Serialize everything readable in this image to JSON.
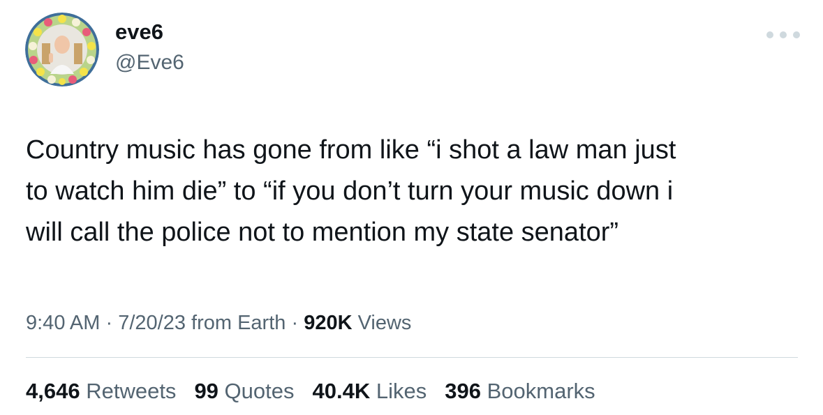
{
  "author": {
    "display_name": "eve6",
    "handle": "@Eve6",
    "avatar_icon": "profile-avatar-flower-wreath"
  },
  "more_icon": "more-options-dots-icon",
  "tweet": {
    "text": "Country music has gone from like “i shot a law man just\nto watch him die” to “if you don’t turn your music down i\nwill call the police not to mention my state senator”"
  },
  "meta": {
    "time": "9:40 AM",
    "date": "7/20/23",
    "source": "from Earth",
    "separator": "·",
    "views_count": "920K",
    "views_label": "Views"
  },
  "stats": {
    "retweets": {
      "count": "4,646",
      "label": "Retweets"
    },
    "quotes": {
      "count": "99",
      "label": "Quotes"
    },
    "likes": {
      "count": "40.4K",
      "label": "Likes"
    },
    "bookmarks": {
      "count": "396",
      "label": "Bookmarks"
    }
  },
  "colors": {
    "text_primary": "#0f1419",
    "text_secondary": "#536471",
    "divider": "#cfd9de"
  }
}
